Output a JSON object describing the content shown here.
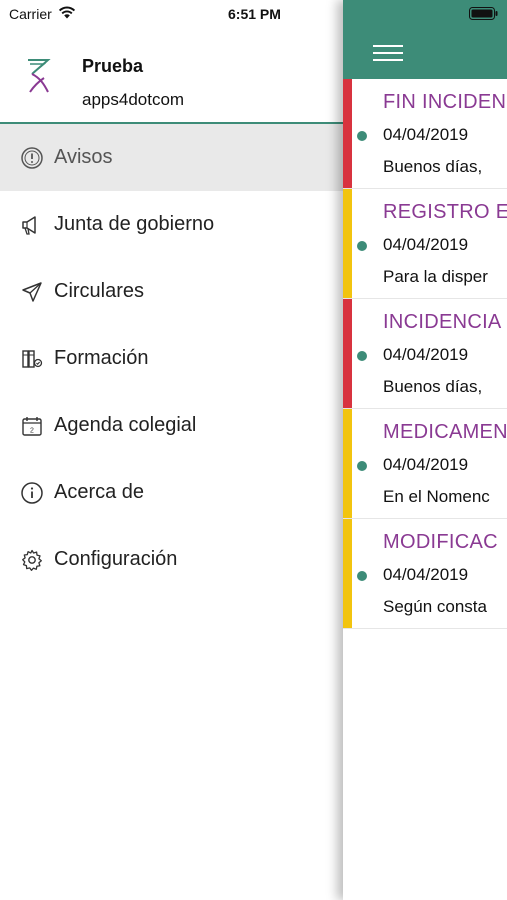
{
  "status_bar": {
    "carrier": "Carrier",
    "time": "6:51 PM"
  },
  "profile": {
    "name": "Prueba",
    "subtitle": "apps4dotcom"
  },
  "menu": {
    "items": [
      {
        "label": "Avisos",
        "icon": "alert-circle-icon",
        "active": true
      },
      {
        "label": "Junta de gobierno",
        "icon": "megaphone-icon"
      },
      {
        "label": "Circulares",
        "icon": "paper-plane-icon"
      },
      {
        "label": "Formación",
        "icon": "books-icon"
      },
      {
        "label": "Agenda colegial",
        "icon": "calendar-icon"
      },
      {
        "label": "Acerca de",
        "icon": "info-icon"
      },
      {
        "label": "Configuración",
        "icon": "gear-icon"
      }
    ]
  },
  "colors": {
    "brand_green": "#3d8c78",
    "title_purple": "#8a3a93",
    "priority_red": "#d8333f",
    "priority_yellow": "#f2c40f"
  },
  "notices": [
    {
      "title": "FIN INCIDEN",
      "date": "04/04/2019",
      "preview": "Buenos días,",
      "priority_color": "#d8333f"
    },
    {
      "title": "REGISTRO E",
      "date": "04/04/2019",
      "preview": "Para la disper",
      "priority_color": "#f2c40f"
    },
    {
      "title": "INCIDENCIA",
      "date": "04/04/2019",
      "preview": "Buenos días,",
      "priority_color": "#d8333f"
    },
    {
      "title": "MEDICAMEN",
      "date": "04/04/2019",
      "preview": "En el Nomenc",
      "priority_color": "#f2c40f"
    },
    {
      "title": "MODIFICAC",
      "date": "04/04/2019",
      "preview": "Según consta",
      "priority_color": "#f2c40f"
    }
  ]
}
